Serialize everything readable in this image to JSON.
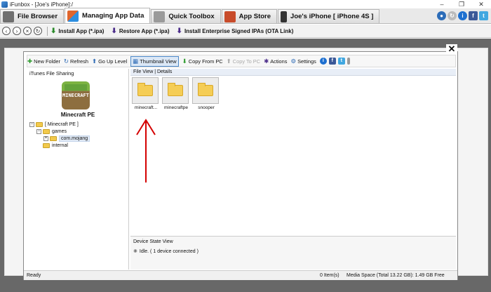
{
  "window": {
    "title": "iFunbox - [Joe's iPhone]:/",
    "controls": [
      "–",
      "❐",
      "✕"
    ]
  },
  "tabs": [
    {
      "label": "File Browser",
      "color": "#6a6a6a"
    },
    {
      "label": "Managing App Data",
      "color": "#e0662d"
    },
    {
      "label": "Quick Toolbox",
      "color": "#8a8a8a"
    },
    {
      "label": "App Store",
      "color": "#c84b2a"
    },
    {
      "label": "Joe's iPhone [ iPhone 4S ]",
      "color": "#333333"
    }
  ],
  "toolbar": {
    "install_app": "Install App (*.ipa)",
    "restore_app": "Restore App (*.ipa)",
    "install_enterprise": "Install Enterprise Signed IPAs (OTA Link)"
  },
  "dialog": {
    "toolbar": {
      "new_folder": "New Folder",
      "refresh": "Refresh",
      "go_up": "Go Up Level",
      "thumbnail_view": "Thumbnail View",
      "copy_from_pc": "Copy From PC",
      "copy_to_pc": "Copy To PC",
      "actions": "Actions",
      "settings": "Settings"
    },
    "left": {
      "header": "iTunes File Sharing",
      "app_tile_text": "MINECRAFT",
      "app_name": "Minecraft PE",
      "tree": [
        {
          "label": "[ Minecraft PE ]",
          "expander": "−"
        },
        {
          "label": "games",
          "expander": "−"
        },
        {
          "label": "com.mojang",
          "expander": "+"
        },
        {
          "label": "internal",
          "expander": ""
        }
      ]
    },
    "right": {
      "view_tabs": "File View | Details",
      "items": [
        {
          "name": "minecraft..."
        },
        {
          "name": "minecraftpe"
        },
        {
          "name": "snooper"
        }
      ]
    },
    "state": {
      "header": "Device State View",
      "status": "Idle. ( 1 device connected )"
    },
    "statusbar": {
      "ready": "Ready",
      "items": "0 Item(s)",
      "space": "Media Space (Total 13.22 GB): 1.49 GB Free"
    }
  },
  "colors": {
    "accent_arrow": "#d40000",
    "selection": "#dce8f6"
  }
}
